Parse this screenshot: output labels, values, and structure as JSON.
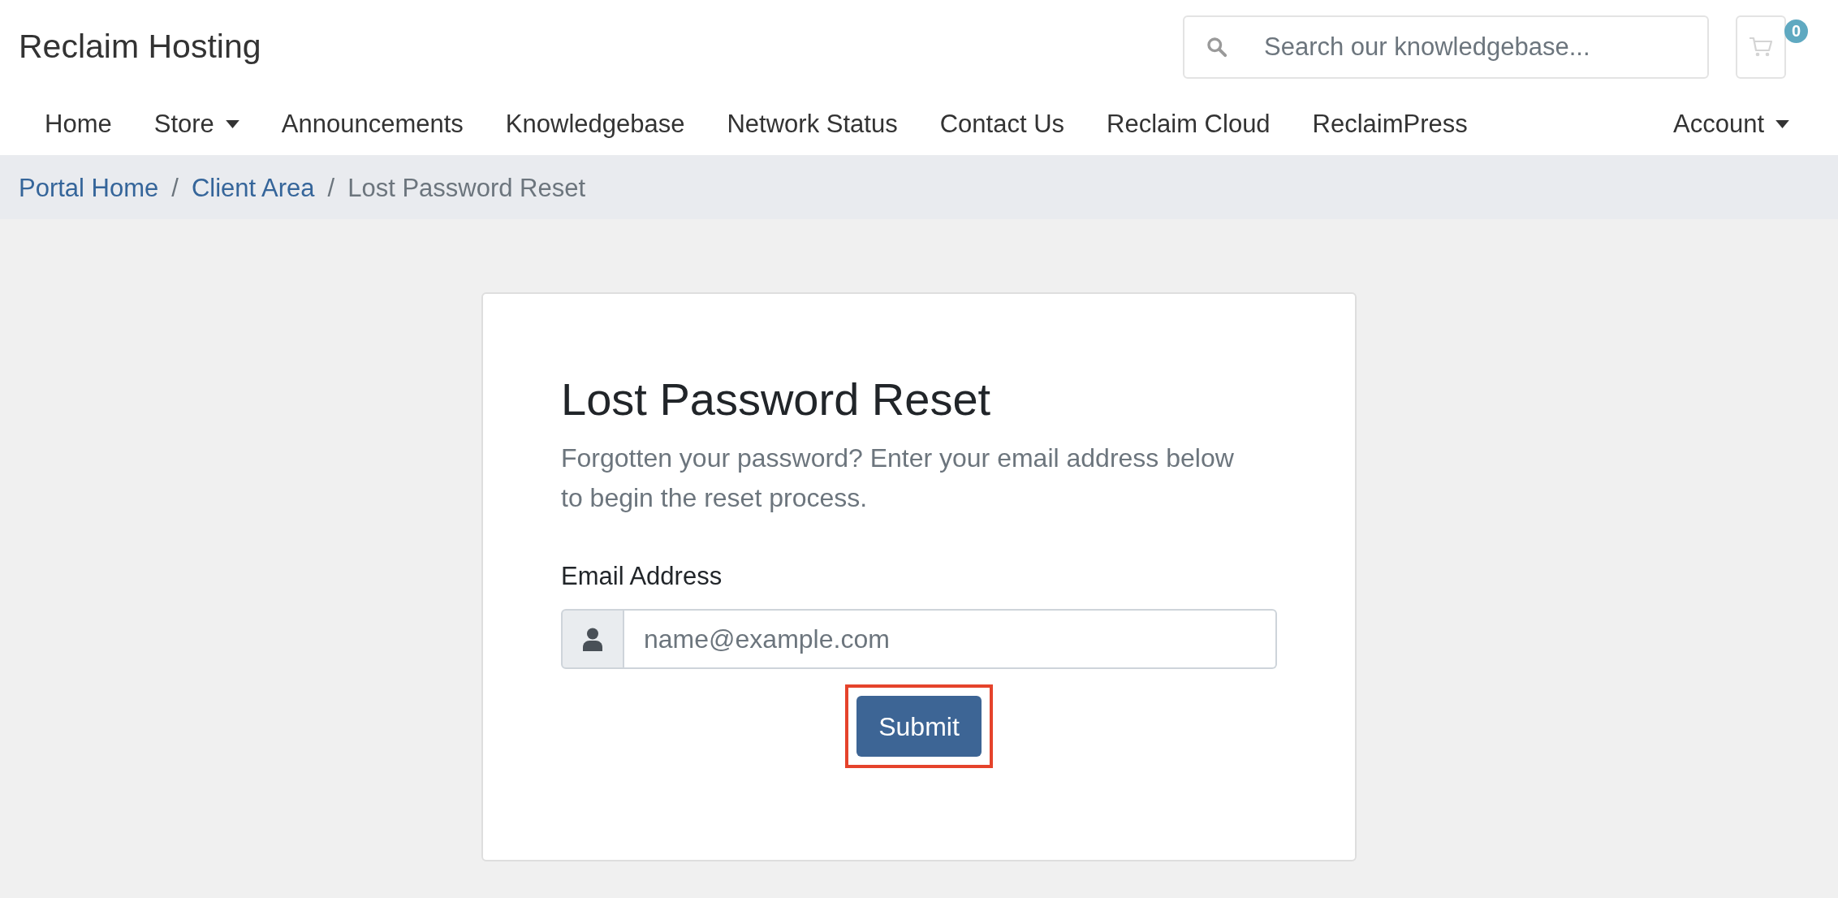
{
  "header": {
    "logo": "Reclaim Hosting",
    "search": {
      "placeholder": "Search our knowledgebase..."
    },
    "cart": {
      "count": "0"
    }
  },
  "nav": {
    "items": [
      {
        "label": "Home",
        "dropdown": false
      },
      {
        "label": "Store",
        "dropdown": true
      },
      {
        "label": "Announcements",
        "dropdown": false
      },
      {
        "label": "Knowledgebase",
        "dropdown": false
      },
      {
        "label": "Network Status",
        "dropdown": false
      },
      {
        "label": "Contact Us",
        "dropdown": false
      },
      {
        "label": "Reclaim Cloud",
        "dropdown": false
      },
      {
        "label": "ReclaimPress",
        "dropdown": false
      }
    ],
    "account": {
      "label": "Account",
      "dropdown": true
    }
  },
  "breadcrumb": [
    {
      "kind": "link",
      "label": "Portal Home"
    },
    {
      "kind": "separator",
      "label": "/"
    },
    {
      "kind": "link",
      "label": "Client Area"
    },
    {
      "kind": "separator",
      "label": "/"
    },
    {
      "kind": "current",
      "label": "Lost Password Reset"
    }
  ],
  "card": {
    "title": "Lost Password Reset",
    "description": "Forgotten your password? Enter your email address below to begin the reset process.",
    "email": {
      "label": "Email Address",
      "placeholder": "name@example.com"
    },
    "submit": {
      "label": "Submit",
      "highlighted": true
    }
  }
}
